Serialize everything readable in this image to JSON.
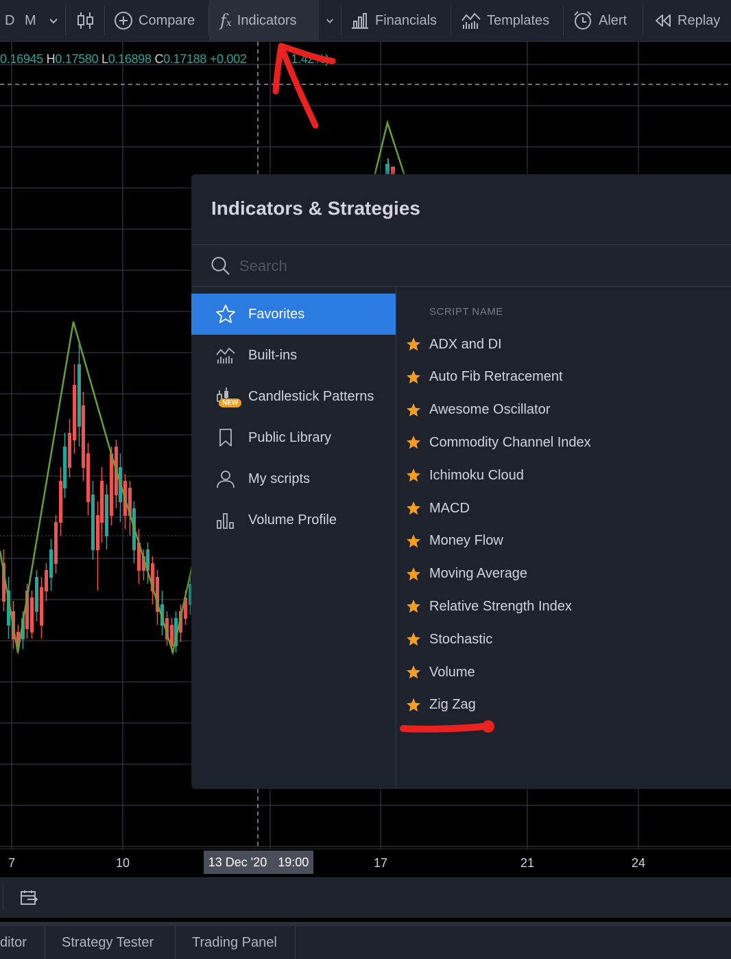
{
  "toolbar": {
    "intervals": [
      "D",
      "M"
    ],
    "compare_label": "Compare",
    "indicators_label": "Indicators",
    "financials_label": "Financials",
    "templates_label": "Templates",
    "alert_label": "Alert",
    "replay_label": "Replay"
  },
  "legend": {
    "o_label": "O",
    "o_value": "0.16945",
    "h_label": "H",
    "h_value": "0.17580",
    "l_label": "L",
    "l_value": "0.16898",
    "c_label": "C",
    "c_value": "0.17188",
    "change": "+0.002",
    "change_pct": "1.42%)"
  },
  "time_axis": {
    "ticks": [
      "7",
      "10",
      "17",
      "21",
      "24"
    ],
    "crosshair_date": "13 Dec '20",
    "crosshair_time": "19:00"
  },
  "dialog": {
    "title": "Indicators & Strategies",
    "search_placeholder": "Search",
    "categories": [
      {
        "label": "Favorites",
        "icon": "star-outline-icon",
        "selected": true
      },
      {
        "label": "Built-ins",
        "icon": "chart-bars-icon"
      },
      {
        "label": "Candlestick Patterns",
        "icon": "candlestick-icon",
        "badge": "NEW"
      },
      {
        "label": "Public Library",
        "icon": "bookmark-icon"
      },
      {
        "label": "My scripts",
        "icon": "user-icon"
      },
      {
        "label": "Volume Profile",
        "icon": "volume-profile-icon"
      }
    ],
    "column_header": "SCRIPT NAME",
    "scripts": [
      "ADX and DI",
      "Auto Fib Retracement",
      "Awesome Oscillator",
      "Commodity Channel Index",
      "Ichimoku Cloud",
      "MACD",
      "Money Flow",
      "Moving Average",
      "Relative Strength Index",
      "Stochastic",
      "Volume",
      "Zig Zag"
    ]
  },
  "bottom_tabs": [
    "ditor",
    "Strategy Tester",
    "Trading Panel"
  ],
  "colors": {
    "background": "#000000",
    "panel": "#1e222d",
    "accent": "#2c7be0",
    "star": "#f59d21",
    "up": "#26a69a",
    "down": "#ef5350",
    "zigzag": "#689f38",
    "annotation": "#e8231f"
  }
}
